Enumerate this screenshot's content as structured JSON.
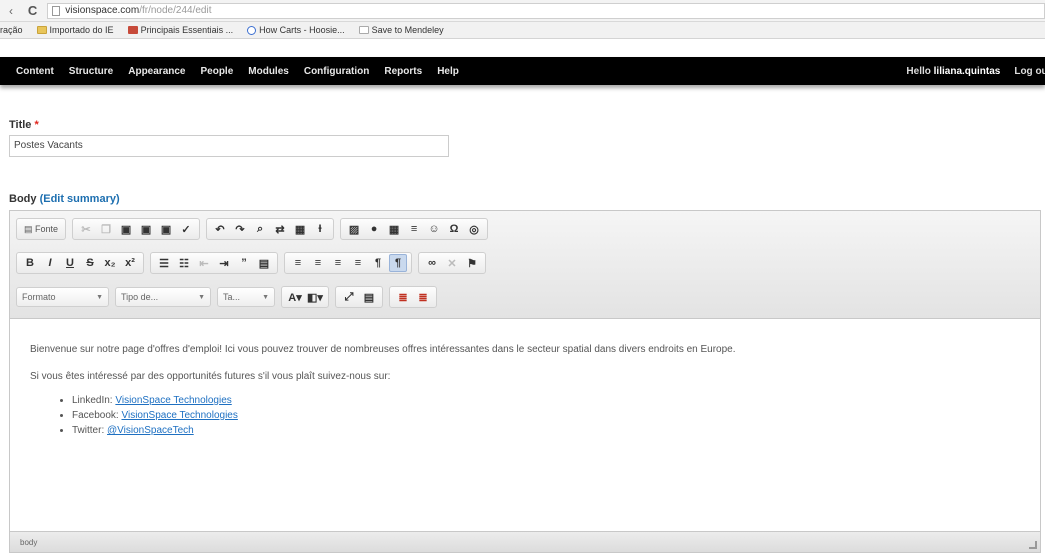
{
  "browser": {
    "url_main": "visionspace.com",
    "url_rest": "/fr/node/244/edit",
    "bookmarks": [
      {
        "label": "ração",
        "icon": "none"
      },
      {
        "label": "Importado do IE",
        "icon": "folder"
      },
      {
        "label": "Principais Essentiais ...",
        "icon": "calendar"
      },
      {
        "label": "How Carts - Hoosie...",
        "icon": "circle"
      },
      {
        "label": "Save to Mendeley",
        "icon": "page"
      }
    ]
  },
  "toolbar": {
    "items": [
      "Content",
      "Structure",
      "Appearance",
      "People",
      "Modules",
      "Configuration",
      "Reports",
      "Help"
    ],
    "hello_prefix": "Hello ",
    "username": "liliana.quintas",
    "logout": "Log out"
  },
  "form": {
    "title_label": "Title",
    "required_mark": "*",
    "title_value": "Postes Vacants",
    "body_label": "Body",
    "edit_summary": "(Edit summary)"
  },
  "editor": {
    "source_label": "Fonte",
    "format_label": "Formato",
    "font_label": "Tipo de...",
    "size_label": "Ta...",
    "paragraphs": [
      "Bienvenue sur notre page d'offres d'emploi! Ici vous pouvez trouver de nombreuses offres intéressantes dans le secteur spatial dans divers endroits en Europe.",
      "Si vous êtes intéressé par des opportunités futures s'il vous plaît suivez-nous sur:"
    ],
    "links": [
      {
        "label": "LinkedIn: ",
        "link": "VisionSpace Technologies"
      },
      {
        "label": "Facebook: ",
        "link": "VisionSpace Technologies"
      },
      {
        "label": "Twitter: ",
        "link": "@VisionSpaceTech"
      }
    ],
    "path_label": "body"
  }
}
